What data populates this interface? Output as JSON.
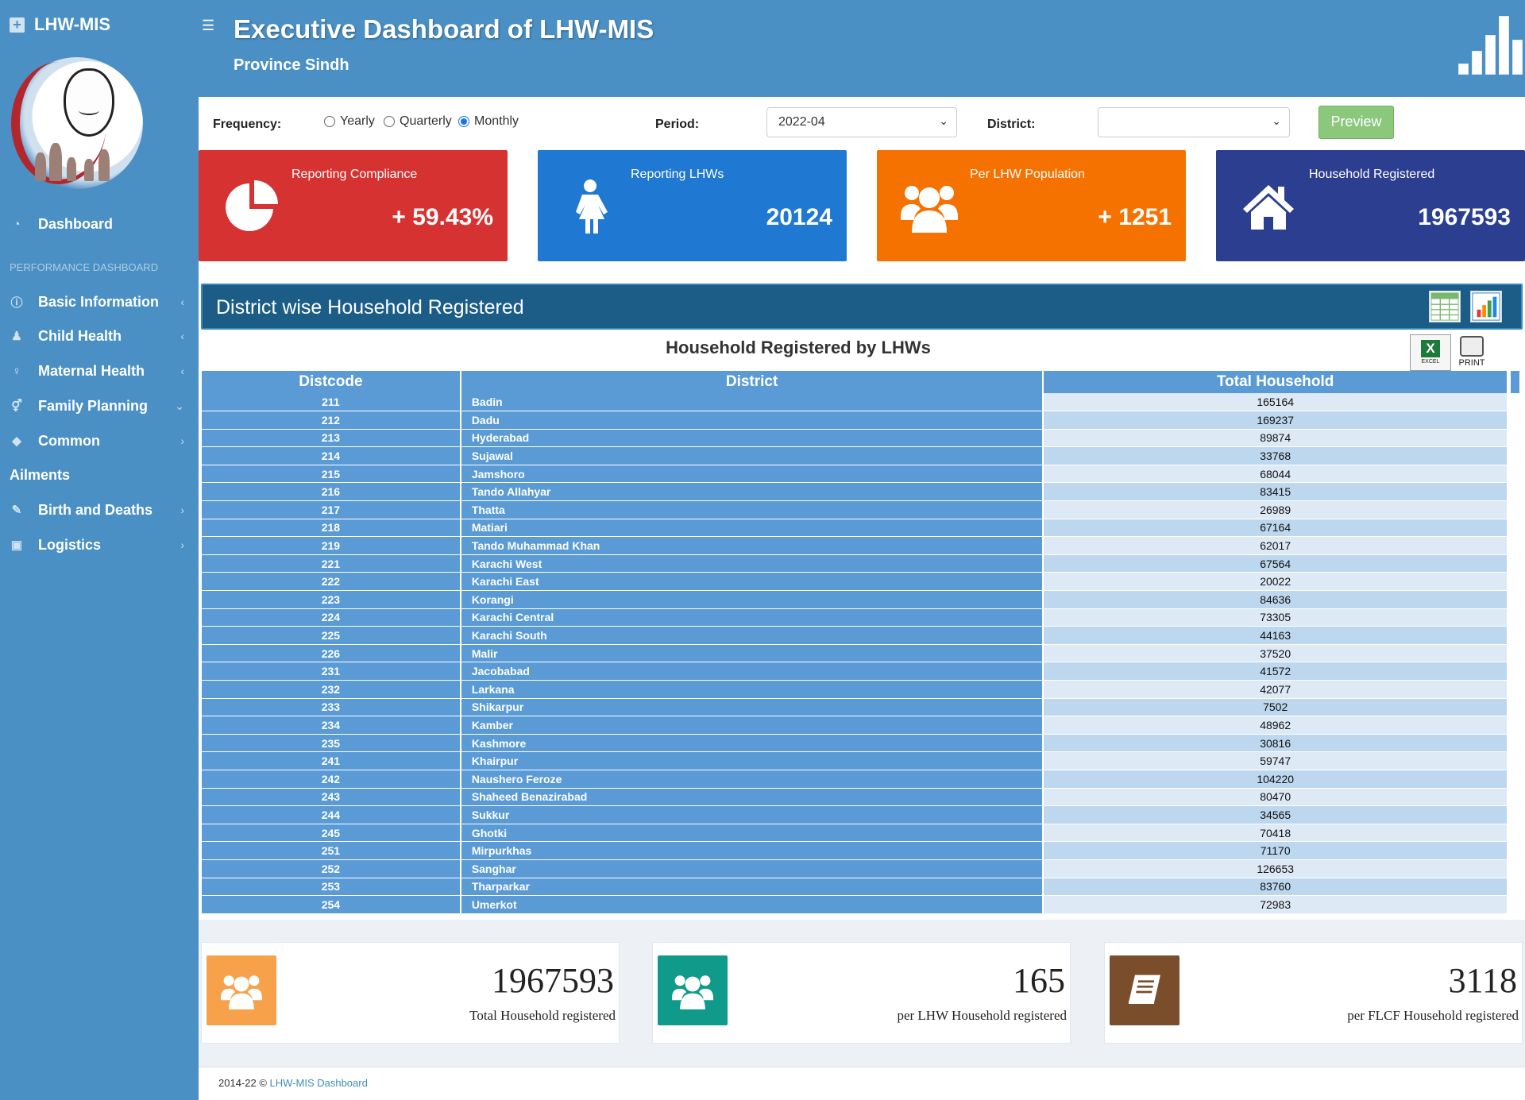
{
  "sidebar": {
    "brand": "LHW-MIS",
    "dashboard": "Dashboard",
    "section_header": "PERFORMANCE DASHBOARD",
    "items": [
      {
        "label": "Basic Information",
        "chevron": "‹"
      },
      {
        "label": "Child Health",
        "chevron": "‹"
      },
      {
        "label": "Maternal Health",
        "chevron": "‹"
      },
      {
        "label": "Family Planning",
        "chevron": "⌄"
      },
      {
        "label": "Common",
        "chevron": "›"
      },
      {
        "label": "Ailments",
        "chevron": ""
      },
      {
        "label": "Birth and Deaths",
        "chevron": "›"
      },
      {
        "label": "Logistics",
        "chevron": "›"
      }
    ]
  },
  "header": {
    "title": "Executive Dashboard of LHW-MIS",
    "subtitle": "Province Sindh"
  },
  "filters": {
    "frequency_label": "Frequency:",
    "frequency_options": [
      "Yearly",
      "Quarterly",
      "Monthly"
    ],
    "frequency_selected": "Monthly",
    "period_label": "Period:",
    "period_value": "2022-04",
    "district_label": "District:",
    "district_value": "",
    "preview_label": "Preview"
  },
  "cards": [
    {
      "title": "Reporting Compliance",
      "value": "+ 59.43%",
      "color": "#d73232",
      "icon": "pie-chart-icon"
    },
    {
      "title": "Reporting LHWs",
      "value": "20124",
      "color": "#1f78d1",
      "icon": "female-icon"
    },
    {
      "title": "Per LHW Population",
      "value": "+ 1251",
      "color": "#f57200",
      "icon": "users-icon"
    },
    {
      "title": "Household Registered",
      "value": "1967593",
      "color": "#2c3e8f",
      "icon": "home-icon"
    }
  ],
  "panel": {
    "title": "District wise Household Registered",
    "table_title": "Household Registered by LHWs",
    "excel_label": "EXCEL",
    "print_label": "PRINT"
  },
  "table": {
    "headers": [
      "Distcode",
      "District",
      "Total Household"
    ],
    "rows": [
      [
        "211",
        "Badin",
        "165164"
      ],
      [
        "212",
        "Dadu",
        "169237"
      ],
      [
        "213",
        "Hyderabad",
        "89874"
      ],
      [
        "214",
        "Sujawal",
        "33768"
      ],
      [
        "215",
        "Jamshoro",
        "68044"
      ],
      [
        "216",
        "Tando Allahyar",
        "83415"
      ],
      [
        "217",
        "Thatta",
        "26989"
      ],
      [
        "218",
        "Matiari",
        "67164"
      ],
      [
        "219",
        "Tando Muhammad Khan",
        "62017"
      ],
      [
        "221",
        "Karachi West",
        "67564"
      ],
      [
        "222",
        "Karachi East",
        "20022"
      ],
      [
        "223",
        "Korangi",
        "84636"
      ],
      [
        "224",
        "Karachi Central",
        "73305"
      ],
      [
        "225",
        "Karachi South",
        "44163"
      ],
      [
        "226",
        "Malir",
        "37520"
      ],
      [
        "231",
        "Jacobabad",
        "41572"
      ],
      [
        "232",
        "Larkana",
        "42077"
      ],
      [
        "233",
        "Shikarpur",
        "7502"
      ],
      [
        "234",
        "Kamber",
        "48962"
      ],
      [
        "235",
        "Kashmore",
        "30816"
      ],
      [
        "241",
        "Khairpur",
        "59747"
      ],
      [
        "242",
        "Naushero Feroze",
        "104220"
      ],
      [
        "243",
        "Shaheed Benazirabad",
        "80470"
      ],
      [
        "244",
        "Sukkur",
        "34565"
      ],
      [
        "245",
        "Ghotki",
        "70418"
      ],
      [
        "251",
        "Mirpurkhas",
        "71170"
      ],
      [
        "252",
        "Sanghar",
        "126653"
      ],
      [
        "253",
        "Tharparkar",
        "83760"
      ],
      [
        "254",
        "Umerkot",
        "72983"
      ]
    ]
  },
  "stats": [
    {
      "value": "1967593",
      "label": "Total Household registered",
      "color": "#f7a24a",
      "icon": "users-icon"
    },
    {
      "value": "165",
      "label": "per LHW Household registered",
      "color": "#0f9a8a",
      "icon": "users-icon"
    },
    {
      "value": "3118",
      "label": "per FLCF Household registered",
      "color": "#7a4e2b",
      "icon": "book-icon"
    }
  ],
  "footer": {
    "text": "2014-22 © ",
    "link": "LHW-MIS Dashboard"
  }
}
